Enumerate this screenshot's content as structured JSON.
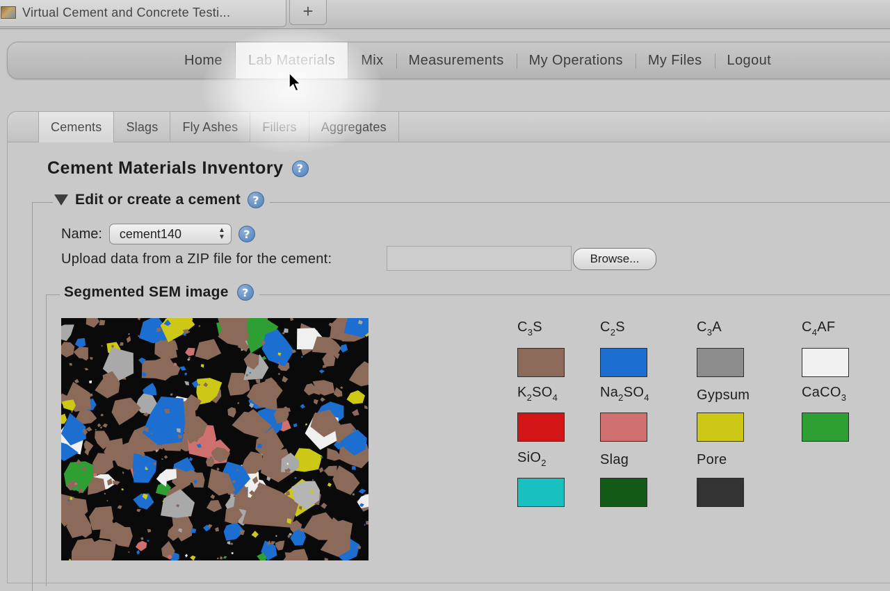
{
  "browser": {
    "tab_title": "Virtual Cement and Concrete Testi...",
    "new_tab_symbol": "+"
  },
  "nav": {
    "items": [
      {
        "label": "Home",
        "active": false
      },
      {
        "label": "Lab Materials",
        "active": true
      },
      {
        "label": "Mix",
        "active": false
      },
      {
        "label": "Measurements",
        "active": false
      },
      {
        "label": "My Operations",
        "active": false
      },
      {
        "label": "My Files",
        "active": false
      },
      {
        "label": "Logout",
        "active": false
      }
    ]
  },
  "subtabs": {
    "items": [
      {
        "label": "Cements",
        "active": true
      },
      {
        "label": "Slags",
        "active": false
      },
      {
        "label": "Fly Ashes",
        "active": false
      },
      {
        "label": "Fillers",
        "active": false
      },
      {
        "label": "Aggregates",
        "active": false
      }
    ]
  },
  "page": {
    "title": "Cement Materials Inventory",
    "help_symbol": "?"
  },
  "edit": {
    "legend": "Edit or create a cement",
    "name_label": "Name:",
    "name_value": "cement140",
    "upload_label": "Upload data from a ZIP file for the cement:",
    "browse_label": "Browse..."
  },
  "sem": {
    "legend": "Segmented SEM image"
  },
  "phases": [
    {
      "main": "C",
      "sub": "3",
      "rest": "S",
      "rest_sub": "",
      "color": "#8b6a5a"
    },
    {
      "main": "C",
      "sub": "2",
      "rest": "S",
      "rest_sub": "",
      "color": "#1c6fd1"
    },
    {
      "main": "C",
      "sub": "3",
      "rest": "A",
      "rest_sub": "",
      "color": "#8c8c8c"
    },
    {
      "main": "C",
      "sub": "4",
      "rest": "AF",
      "rest_sub": "",
      "color": "#f0f0f0"
    },
    {
      "main": "K",
      "sub": "2",
      "rest": "SO",
      "rest_sub": "4",
      "color": "#d21515"
    },
    {
      "main": "Na",
      "sub": "2",
      "rest": "SO",
      "rest_sub": "4",
      "color": "#d0706e"
    },
    {
      "main": "Gypsum",
      "sub": "",
      "rest": "",
      "rest_sub": "",
      "color": "#cdc716"
    },
    {
      "main": "CaCO",
      "sub": "3",
      "rest": "",
      "rest_sub": "",
      "color": "#2e9f32"
    },
    {
      "main": "SiO",
      "sub": "2",
      "rest": "",
      "rest_sub": "",
      "color": "#19c0c0"
    },
    {
      "main": "Slag",
      "sub": "",
      "rest": "",
      "rest_sub": "",
      "color": "#135a17"
    },
    {
      "main": "Pore",
      "sub": "",
      "rest": "",
      "rest_sub": "",
      "color": "#333333"
    }
  ]
}
